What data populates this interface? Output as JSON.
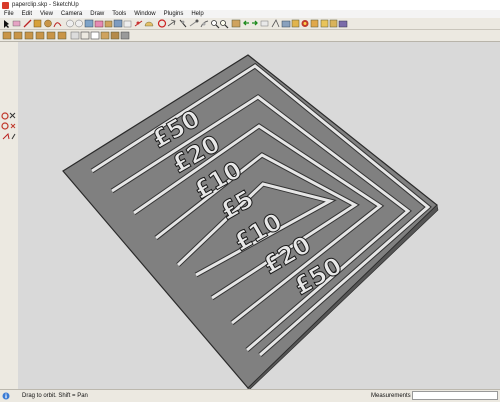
{
  "window": {
    "title": "paperclip.skp - SketchUp"
  },
  "menu": [
    "File",
    "Edit",
    "View",
    "Camera",
    "Draw",
    "Tools",
    "Window",
    "Plugins",
    "Help"
  ],
  "toolbar": {
    "row1_icons": [
      "select-icon",
      "eraser-icon",
      "line-icon",
      "rectangle-icon",
      "circle-icon",
      "arc-icon",
      "move-icon",
      "pushpull-icon",
      "rotate-icon",
      "followme-icon",
      "scale-icon",
      "offset-icon",
      "tape-icon",
      "dimension-icon",
      "protractor-icon",
      "text-icon",
      "axes-icon",
      "3dtext-icon",
      "orbit-icon",
      "pan-icon",
      "zoom-icon",
      "zoom-window-icon",
      "zoom-extents-icon",
      "previous-icon",
      "next-icon",
      "position-camera-icon",
      "walk-icon",
      "lookaround-icon",
      "section-icon",
      "paint-icon",
      "component-icon",
      "get-models-icon",
      "share-model-icon",
      "extension-icon"
    ],
    "row2_icons": [
      "iso-view-icon",
      "top-view-icon",
      "front-view-icon",
      "right-view-icon",
      "back-view-icon",
      "left-view-icon",
      "xray-icon",
      "wireframe-icon",
      "hidden-line-icon",
      "shaded-icon",
      "shaded-textures-icon",
      "monochrome-icon"
    ]
  },
  "left_tools": [
    "orbit-icon",
    "pan-icon",
    "zoom-icon",
    "zoom-extents-icon",
    "walk-icon"
  ],
  "model": {
    "labels_upper": [
      "£50",
      "£20",
      "£10",
      "£5"
    ],
    "labels_lower": [
      "£10",
      "£20",
      "£50"
    ]
  },
  "status": {
    "hint": "Drag to orbit.  Shift = Pan",
    "measurements_label": "Measurements",
    "measurements_value": ""
  },
  "colors": {
    "viewport_bg": "#d9d9d9",
    "slab_face": "#808080",
    "slot_fill": "#e2e2e2",
    "text_fill": "#e8e8e8"
  }
}
